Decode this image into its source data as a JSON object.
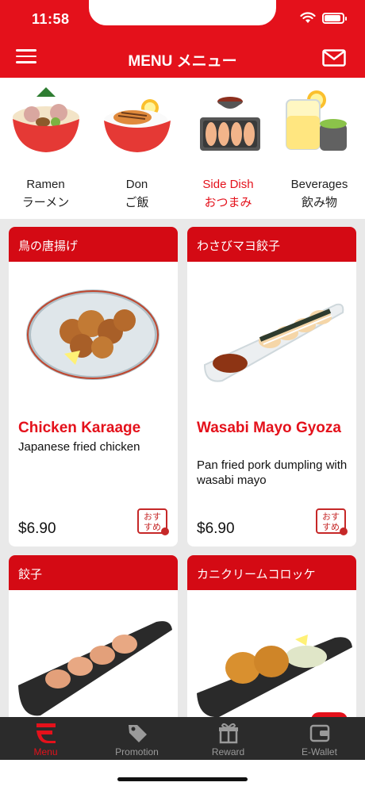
{
  "status": {
    "time": "11:58",
    "battery_level": 0.9
  },
  "header": {
    "title": "MENU メニュー"
  },
  "categories": [
    {
      "en": "Ramen",
      "jp": "ラーメン",
      "icon": "ramen-bowl-icon",
      "active": false
    },
    {
      "en": "Don",
      "jp": "ご飯",
      "icon": "rice-bowl-icon",
      "active": false
    },
    {
      "en": "Side Dish",
      "jp": "おつまみ",
      "icon": "gyoza-plate-icon",
      "active": true
    },
    {
      "en": "Beverages",
      "jp": "飲み物",
      "icon": "drinks-icon",
      "active": false
    }
  ],
  "items": [
    {
      "jp": "鳥の唐揚げ",
      "name": "Chicken Karaage",
      "desc": "Japanese fried chicken",
      "price": "$6.90",
      "badge": "おすすめ"
    },
    {
      "jp": "わさびマヨ餃子",
      "name": "Wasabi Mayo Gyoza",
      "desc": "Pan fried pork dumpling with wasabi mayo",
      "price": "$6.90",
      "badge": "おすすめ"
    },
    {
      "jp": "餃子"
    },
    {
      "jp": "カニクリームコロッケ"
    }
  ],
  "tabs": [
    {
      "label": "Menu",
      "icon": "menu-bowl-icon",
      "active": true
    },
    {
      "label": "Promotion",
      "icon": "tag-icon",
      "active": false
    },
    {
      "label": "Reward",
      "icon": "gift-icon",
      "active": false
    },
    {
      "label": "E-Wallet",
      "icon": "wallet-icon",
      "active": false
    }
  ],
  "colors": {
    "brand": "#e4111b",
    "tabbar": "#2b2b2b"
  }
}
